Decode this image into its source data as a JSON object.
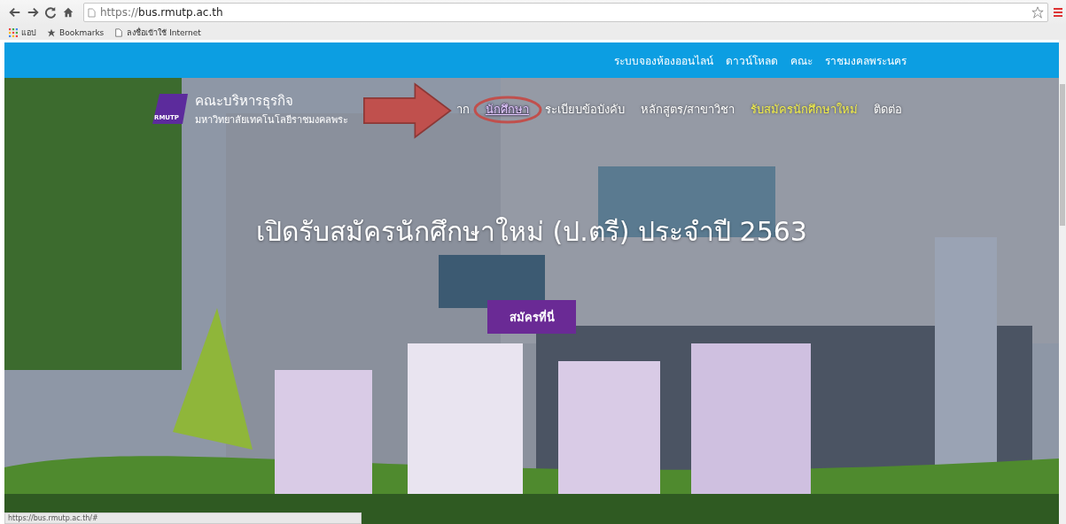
{
  "browser": {
    "url_scheme": "https://",
    "url_host": "bus.rmutp.ac.th",
    "bookmarks": [
      {
        "kind": "apps",
        "label": "แอป"
      },
      {
        "kind": "star",
        "label": "Bookmarks"
      },
      {
        "kind": "page",
        "label": "ลงชื่อเข้าใช้ Internet"
      }
    ]
  },
  "top_bar": {
    "links": [
      "ระบบจองห้องออนไลน์",
      "ดาวน์โหลด",
      "คณะ",
      "ราชมงคลพระนคร"
    ]
  },
  "header": {
    "logo_text": "RMUTP",
    "title": "คณะบริหารธุรกิจ",
    "subtitle": "มหาวิทยาลัยเทคโนโลยีราชมงคลพระ",
    "nav": [
      {
        "label": "าก",
        "selected": false,
        "kind": "normal"
      },
      {
        "label": "นักศึกษา",
        "selected": true,
        "kind": "normal"
      },
      {
        "label": "ระเบียบข้อบังคับ",
        "selected": false,
        "kind": "normal"
      },
      {
        "label": "หลักสูตร/สาขาวิชา",
        "selected": false,
        "kind": "normal"
      },
      {
        "label": "รับสมัครนักศึกษาใหม่",
        "selected": false,
        "kind": "featured"
      },
      {
        "label": "ติดต่อ",
        "selected": false,
        "kind": "normal"
      }
    ]
  },
  "hero": {
    "kind": "picture",
    "heading": "เปิดรับสมัครนักศึกษาใหม่ (ป.ตรี) ประจำปี 2563",
    "button": "สมัครที่นี่"
  },
  "status_bar": {
    "text": "https://bus.rmutp.ac.th/#"
  }
}
